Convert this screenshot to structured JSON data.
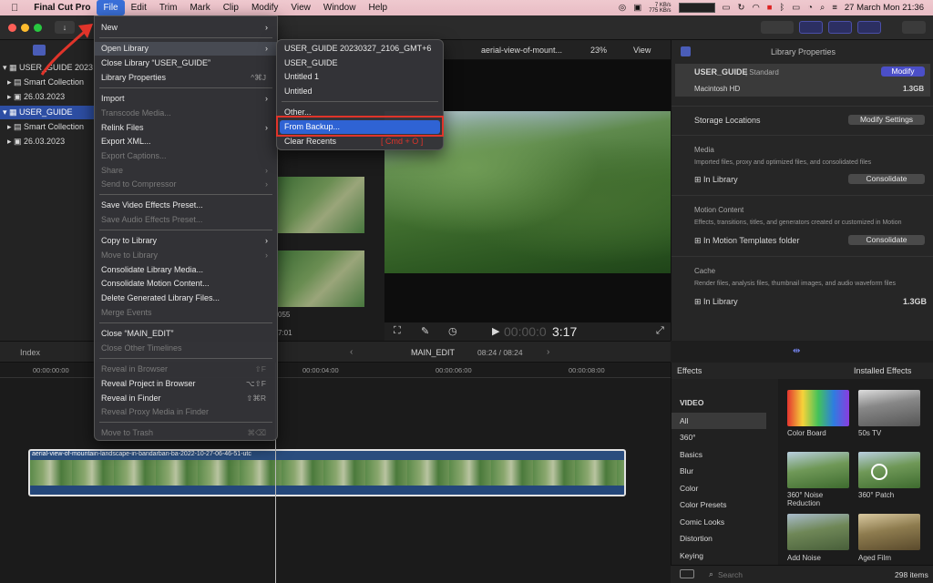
{
  "menubar": {
    "app_name": "Final Cut Pro",
    "items": [
      "File",
      "Edit",
      "Trim",
      "Mark",
      "Clip",
      "Modify",
      "View",
      "Window",
      "Help"
    ],
    "net_up": "7 KB/s",
    "net_down": "775 KB/s",
    "datetime": "27 March Mon  21:36"
  },
  "sidebar": {
    "rows": [
      {
        "label": "USER_GUIDE 2023"
      },
      {
        "label": "Smart Collection"
      },
      {
        "label": "26.03.2023"
      },
      {
        "label": "USER_GUIDE"
      },
      {
        "label": "Smart Collection"
      },
      {
        "label": "26.03.2023"
      }
    ]
  },
  "browser": {
    "clip_number": "055",
    "clip_duration": "7:01"
  },
  "viewer": {
    "clip_name": "aerial-view-of-mount...",
    "zoom": "23%",
    "view_label": "View",
    "timecode_dim": "00:00:0",
    "timecode_bright": "3:17"
  },
  "inspector": {
    "title": "Library Properties",
    "library_name": "USER_GUIDE",
    "library_type": "| Standard",
    "modify_label": "Modify",
    "disk": "Macintosh HD",
    "disk_size": "1.3GB",
    "storage_title": "Storage Locations",
    "modify_settings": "Modify Settings",
    "media_title": "Media",
    "media_desc": "Imported files, proxy and optimized files, and consolidated files",
    "media_loc": "In Library",
    "consolidate": "Consolidate",
    "motion_title": "Motion Content",
    "motion_desc": "Effects, transitions, titles, and generators created or customized in Motion",
    "motion_loc": "In Motion Templates folder",
    "cache_title": "Cache",
    "cache_desc": "Render files, analysis files, thumbnail images, and audio waveform files",
    "cache_loc": "In Library",
    "cache_size": "1.3GB"
  },
  "timeline": {
    "index_label": "Index",
    "project_name": "MAIN_EDIT",
    "duration": "08:24 / 08:24",
    "ruler": [
      "00:00:00:00",
      "00:00:04:00",
      "00:00:06:00",
      "00:00:08:00"
    ],
    "clip_title": "aerial-view-of-mountain-landscape-in-bandarban-ba-2022-10-27-06-46-51-utc"
  },
  "effects": {
    "header": "Effects",
    "installed": "Installed Effects",
    "categories": [
      "VIDEO",
      "All",
      "360°",
      "Basics",
      "Blur",
      "Color",
      "Color Presets",
      "Comic Looks",
      "Distortion",
      "Keying"
    ],
    "tiles": [
      {
        "label": "Color Board"
      },
      {
        "label": "50s TV"
      },
      {
        "label": "360° Noise Reduction"
      },
      {
        "label": "360° Patch"
      },
      {
        "label": "Add Noise"
      },
      {
        "label": "Aged Film"
      }
    ],
    "search_placeholder": "Search",
    "count": "298 items"
  },
  "file_menu": {
    "items": [
      {
        "label": "New",
        "arrow": "›"
      },
      {
        "label": "Open Library",
        "arrow": "›"
      },
      {
        "label": "Close Library “USER_GUIDE”"
      },
      {
        "label": "Library Properties",
        "shortcut": "^⌘J"
      },
      {
        "label": "Import",
        "arrow": "›"
      },
      {
        "label": "Transcode Media..."
      },
      {
        "label": "Relink Files",
        "arrow": "›"
      },
      {
        "label": "Export XML..."
      },
      {
        "label": "Export Captions..."
      },
      {
        "label": "Share",
        "arrow": "›"
      },
      {
        "label": "Send to Compressor",
        "arrow": "›"
      },
      {
        "label": "Save Video Effects Preset..."
      },
      {
        "label": "Save Audio Effects Preset..."
      },
      {
        "label": "Copy to Library",
        "arrow": "›"
      },
      {
        "label": "Move to Library",
        "arrow": "›"
      },
      {
        "label": "Consolidate Library Media..."
      },
      {
        "label": "Consolidate Motion Content..."
      },
      {
        "label": "Delete Generated Library Files..."
      },
      {
        "label": "Merge Events"
      },
      {
        "label": "Close “MAIN_EDIT”"
      },
      {
        "label": "Close Other Timelines"
      },
      {
        "label": "Reveal in Browser",
        "shortcut": "⇧F"
      },
      {
        "label": "Reveal Project in Browser",
        "shortcut": "⌥⇧F"
      },
      {
        "label": "Reveal in Finder",
        "shortcut": "⇧⌘R"
      },
      {
        "label": "Reveal Proxy Media in Finder"
      },
      {
        "label": "Move to Trash",
        "shortcut": "⌘⌫"
      }
    ]
  },
  "open_library_submenu": {
    "items": [
      {
        "label": "USER_GUIDE 20230327_2106_GMT+6"
      },
      {
        "label": "USER_GUIDE"
      },
      {
        "label": "Untitled 1"
      },
      {
        "label": "Untitled"
      },
      {
        "label": "Other..."
      },
      {
        "label": "From Backup..."
      },
      {
        "label": "Clear Recents"
      }
    ],
    "hint": "[ Cmd + O ]"
  }
}
